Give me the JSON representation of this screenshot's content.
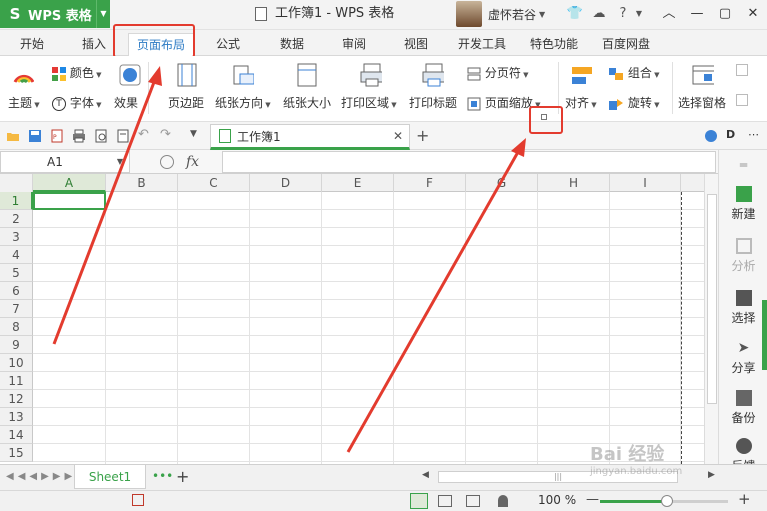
{
  "app": {
    "name": "WPS 表格",
    "logo": "S"
  },
  "window": {
    "title": "工作簿1 - WPS 表格",
    "user": "虚怀若谷"
  },
  "menu": {
    "tabs": [
      "开始",
      "插入",
      "页面布局",
      "公式",
      "数据",
      "审阅",
      "视图",
      "开发工具",
      "特色功能",
      "百度网盘"
    ],
    "active": "页面布局"
  },
  "ribbon": {
    "theme": "主题",
    "colors": "颜色",
    "fonts": "字体",
    "effects": "效果",
    "margins": "页边距",
    "orientation": "纸张方向",
    "size": "纸张大小",
    "print_area": "打印区域",
    "print_titles": "打印标题",
    "page_break": "分页符",
    "page_zoom": "页面缩放",
    "align": "对齐",
    "group": "组合",
    "rotate": "旋转",
    "selection_pane": "选择窗格"
  },
  "workbook_tab": {
    "label": "工作簿1"
  },
  "formula": {
    "namebox": "A1",
    "fx": "fx",
    "value": ""
  },
  "grid": {
    "columns": [
      "A",
      "B",
      "C",
      "D",
      "E",
      "F",
      "G",
      "H",
      "I"
    ],
    "rows": [
      "1",
      "2",
      "3",
      "4",
      "5",
      "6",
      "7",
      "8",
      "9",
      "10",
      "11",
      "12",
      "13",
      "14",
      "15"
    ],
    "active_cell": "A1"
  },
  "right_panel": [
    "新建",
    "分析",
    "选择",
    "分享",
    "备份",
    "反馈"
  ],
  "sheets": [
    "Sheet1"
  ],
  "status": {
    "zoom": "100 %",
    "zoom_level": 0.52
  },
  "watermark": {
    "brand": "Bai 经验",
    "url": "jingyan.baidu.com"
  },
  "colors": {
    "accent": "#3aa24a",
    "highlight": "#e33b2e",
    "link": "#2d7bc4"
  }
}
